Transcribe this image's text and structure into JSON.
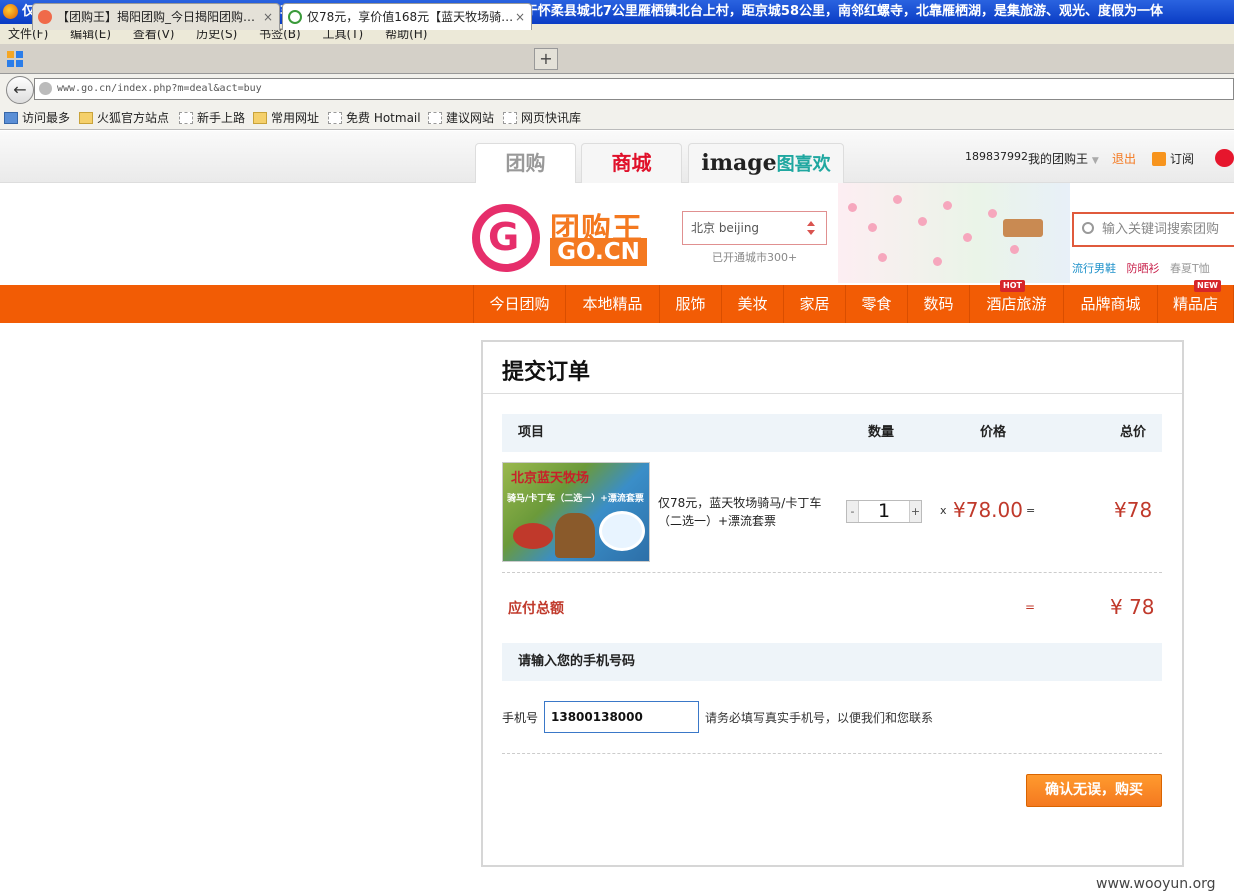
{
  "window": {
    "title": "仅78元，享价值168元【蓝天牧场骑马/卡丁车（二选一）+漂流套票一张】蓝天牧场位于怀柔县城北7公里雁栖镇北台上村，距京城58公里，南邻红螺寺，北靠雁栖湖，是集旅游、观光、度假为一体"
  },
  "menu": [
    "文件(F)",
    "编辑(E)",
    "查看(V)",
    "历史(S)",
    "书签(B)",
    "工具(T)",
    "帮助(H)"
  ],
  "tabs": [
    {
      "label": "【团购王】揭阳团购_今日揭阳团购…",
      "close": "×"
    },
    {
      "label": "仅78元，享价值168元【蓝天牧场骑…",
      "close": "×"
    }
  ],
  "newtab": "+",
  "url": "www.go.cn/index.php?m=deal&act=buy",
  "bookmarks": [
    "访问最多",
    "火狐官方站点",
    "新手上路",
    "常用网址",
    "免费 Hotmail",
    "建议网站",
    "网页快讯库"
  ],
  "site": {
    "channel_tabs": [
      "团购",
      "商城"
    ],
    "image_brand": {
      "latin": "image",
      "cn": "图喜欢"
    },
    "user_id": "189837992",
    "my_account": "我的团购王",
    "logout": "退出",
    "subscribe": "订阅",
    "logo": {
      "cn": "团购王",
      "domain": "GO.CN"
    },
    "city": "北京 beijing",
    "city_note": "已开通城市300+",
    "search_placeholder": "输入关键词搜索团购",
    "hot_words": [
      "流行男鞋",
      "防晒衫",
      "春夏T恤"
    ],
    "nav": [
      "今日团购",
      "本地精品",
      "服饰",
      "美妆",
      "家居",
      "零食",
      "数码",
      "酒店旅游",
      "品牌商城",
      "精品店"
    ],
    "nav_badges": {
      "hotel": "HOT",
      "boutique": "NEW"
    },
    "accent": "#f25c05"
  },
  "order": {
    "title": "提交订单",
    "headers": {
      "item": "项目",
      "qty": "数量",
      "price": "价格",
      "total": "总价"
    },
    "item": {
      "thumb_title": "北京蓝天牧场",
      "thumb_caption": "骑马/卡丁车（二选一）+漂流套票",
      "name": "仅78元，蓝天牧场骑马/卡丁车（二选一）+漂流套票",
      "qty": "1",
      "minus": "-",
      "plus": "+",
      "times": "x",
      "price": "¥78.00",
      "eq": "=",
      "total": "¥78"
    },
    "due_label": "应付总额",
    "due_eq": "=",
    "due_total": "¥ 78",
    "phone_section": "请输入您的手机号码",
    "phone_label": "手机号",
    "phone_value": "13800138000",
    "phone_note": "请务必填写真实手机号，以便我们和您联系",
    "submit": "确认无误，购买"
  },
  "watermark": "www.wooyun.org"
}
